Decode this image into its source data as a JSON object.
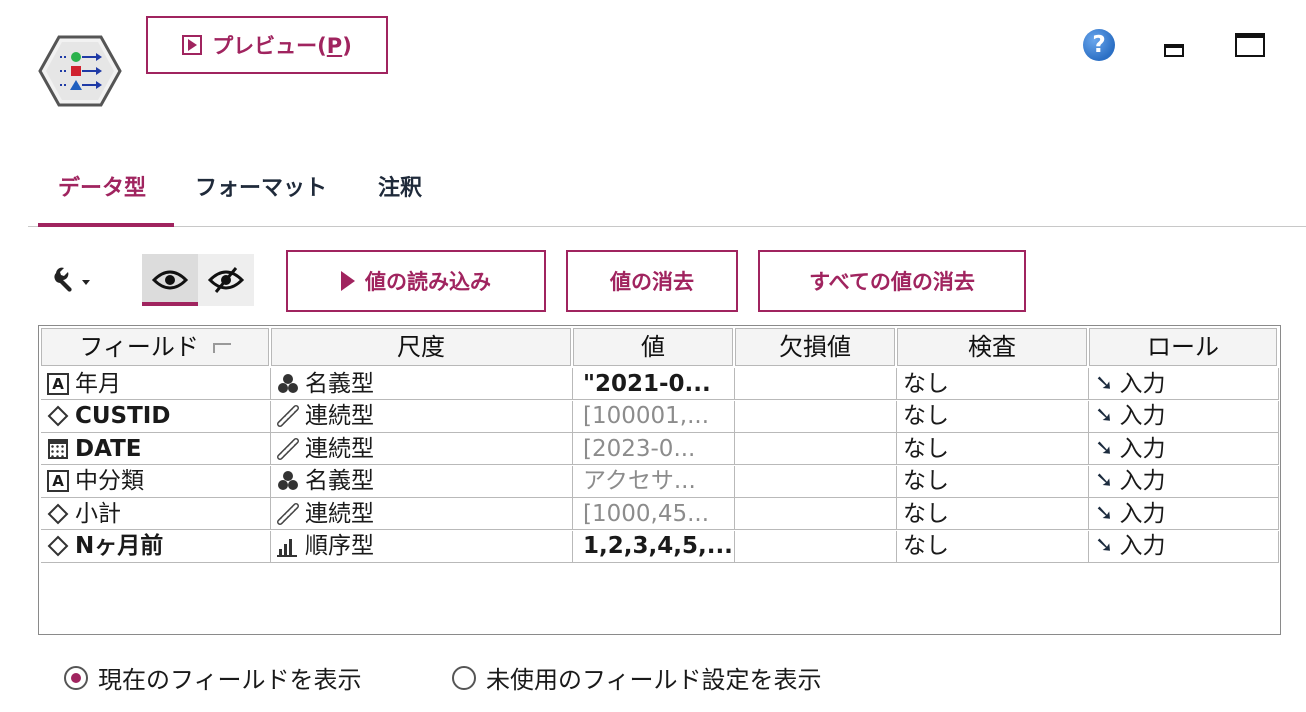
{
  "toolbar": {
    "preview_label": "プレビュー(",
    "preview_mnemonic": "P",
    "preview_suffix": ")"
  },
  "tabs": [
    {
      "label": "データ型",
      "active": true
    },
    {
      "label": "フォーマット",
      "active": false
    },
    {
      "label": "注釈",
      "active": false
    }
  ],
  "actions": {
    "read_values": "値の読み込み",
    "clear_values": "値の消去",
    "clear_all_values": "すべての値の消去"
  },
  "table": {
    "headers": [
      "フィールド",
      "尺度",
      "値",
      "欠損値",
      "検査",
      "ロール"
    ],
    "rows": [
      {
        "field": "年月",
        "field_icon": "string-icon",
        "measure": "名義型",
        "measure_icon": "nominal-icon",
        "values": "\"2021-0...",
        "missing": "",
        "check": "なし",
        "role": "入力"
      },
      {
        "field": "CUSTID",
        "field_icon": "number-icon",
        "measure": "連続型",
        "measure_icon": "continuous-icon",
        "values": "[100001,...",
        "missing": "",
        "check": "なし",
        "role": "入力"
      },
      {
        "field": "DATE",
        "field_icon": "date-icon",
        "measure": "連続型",
        "measure_icon": "continuous-icon",
        "values": "[2023-0...",
        "missing": "",
        "check": "なし",
        "role": "入力"
      },
      {
        "field": "中分類",
        "field_icon": "string-icon",
        "measure": "名義型",
        "measure_icon": "nominal-icon",
        "values": "アクセサ...",
        "missing": "",
        "check": "なし",
        "role": "入力"
      },
      {
        "field": "小計",
        "field_icon": "number-icon",
        "measure": "連続型",
        "measure_icon": "continuous-icon",
        "values": "[1000,45...",
        "missing": "",
        "check": "なし",
        "role": "入力"
      },
      {
        "field": "Nヶ月前",
        "field_icon": "number-icon",
        "measure": "順序型",
        "measure_icon": "ordinal-icon",
        "values": "1,2,3,4,5,...",
        "missing": "",
        "check": "なし",
        "role": "入力"
      }
    ]
  },
  "radios": {
    "current": "現在のフィールドを表示",
    "unused": "未使用のフィールド設定を表示"
  },
  "colors": {
    "accent": "#a0245f",
    "help": "#2b6fc4"
  }
}
